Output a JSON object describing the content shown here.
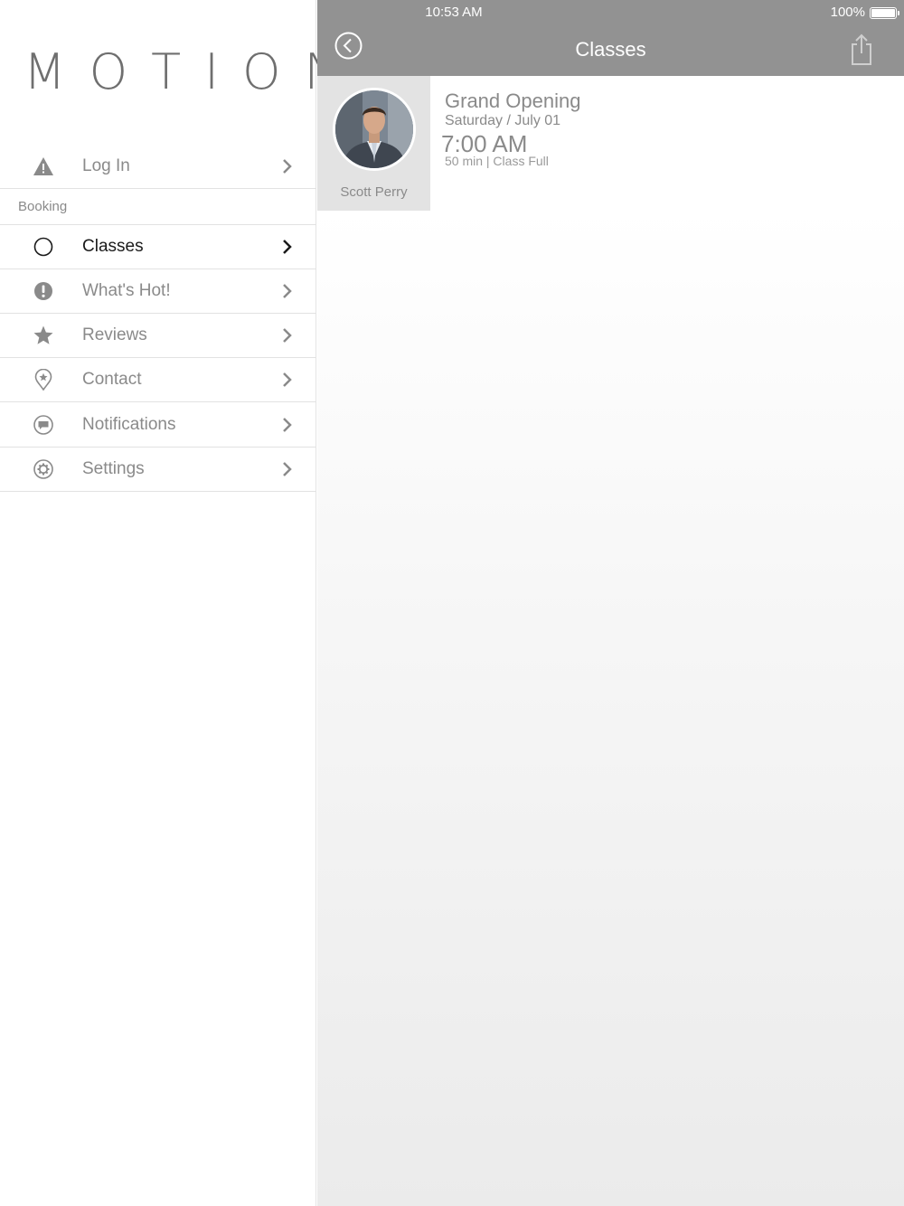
{
  "status_bar": {
    "time": "10:53 AM",
    "battery": "100%"
  },
  "sidebar": {
    "logo": "MOTION",
    "login": {
      "label": "Log In",
      "icon": "warning-icon"
    },
    "section_booking": "Booking",
    "items": [
      {
        "label": "Classes",
        "icon": "circle-icon",
        "active": true
      },
      {
        "label": "What's Hot!",
        "icon": "exclamation-circle-icon",
        "active": false
      },
      {
        "label": "Reviews",
        "icon": "star-icon",
        "active": false
      },
      {
        "label": "Contact",
        "icon": "location-pin-icon",
        "active": false
      },
      {
        "label": "Notifications",
        "icon": "chat-bubble-icon",
        "active": false
      },
      {
        "label": "Settings",
        "icon": "gear-icon",
        "active": false
      }
    ]
  },
  "header": {
    "title": "Classes",
    "back_icon": "back-circle-icon",
    "share_icon": "share-icon"
  },
  "classes": [
    {
      "instructor": "Scott Perry",
      "title": "Grand Opening",
      "date": "Saturday / July 01",
      "time": "7:00 AM",
      "meta": "50 min | Class Full"
    }
  ],
  "colors": {
    "nav_bar": "#929292",
    "text_muted": "#8a8a8a",
    "text_active": "#1a1a1a",
    "instructor_panel": "#e3e3e3"
  }
}
